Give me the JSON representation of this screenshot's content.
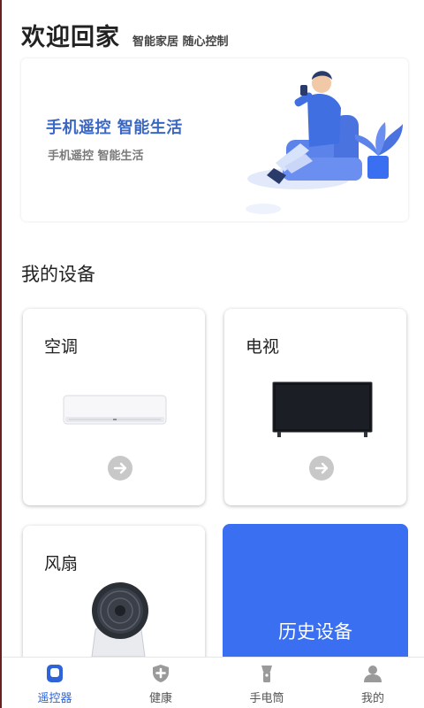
{
  "header": {
    "title": "欢迎回家",
    "subtitle": "智能家居 随心控制"
  },
  "banner": {
    "headline": "手机遥控  智能生活",
    "tagline": "手机遥控 智能生活"
  },
  "devices_section": {
    "title": "我的设备"
  },
  "devices": [
    {
      "name": "空调",
      "icon": "air-conditioner"
    },
    {
      "name": "电视",
      "icon": "television"
    },
    {
      "name": "风扇",
      "icon": "electric-fan"
    }
  ],
  "history": {
    "label": "历史设备"
  },
  "tabs": [
    {
      "label": "遥控器",
      "icon": "remote-icon",
      "active": true
    },
    {
      "label": "健康",
      "icon": "health-shield-icon",
      "active": false
    },
    {
      "label": "手电筒",
      "icon": "flashlight-icon",
      "active": false
    },
    {
      "label": "我的",
      "icon": "profile-icon",
      "active": false
    }
  ],
  "colors": {
    "accent": "#3a6ff2",
    "active_tab": "#2f63d8",
    "headline": "#3a66c4",
    "arrow_button": "#c8c8c8"
  }
}
